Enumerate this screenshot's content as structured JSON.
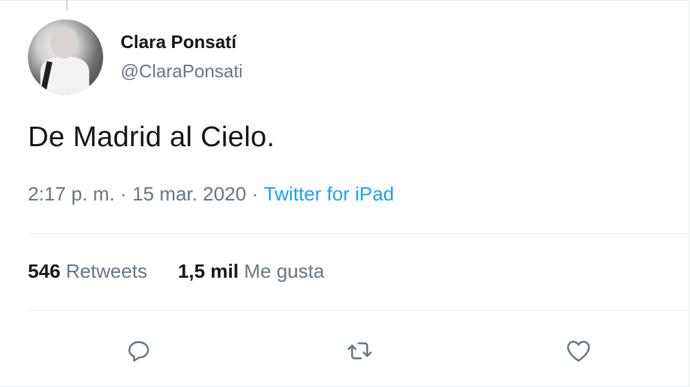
{
  "tweet": {
    "display_name": "Clara Ponsatí",
    "handle": "@ClaraPonsati",
    "text": "De Madrid al Cielo.",
    "time": "2:17 p. m.",
    "separator": "·",
    "date": "15 mar. 2020",
    "source": "Twitter for iPad"
  },
  "stats": {
    "retweets_count": "546",
    "retweets_label": "Retweets",
    "likes_count": "1,5 mil",
    "likes_label": "Me gusta"
  },
  "actions": {
    "reply_icon": "reply-icon",
    "retweet_icon": "retweet-icon",
    "like_icon": "heart-icon"
  },
  "colors": {
    "link": "#1da1f2",
    "secondary_text": "#657786",
    "primary_text": "#14171a"
  }
}
